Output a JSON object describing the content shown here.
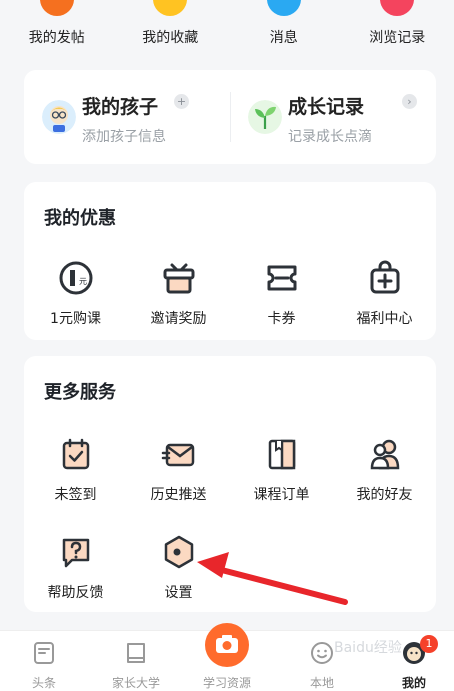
{
  "top_row": [
    {
      "label": "我的发帖",
      "icon": "post-icon",
      "color": "#f5701f"
    },
    {
      "label": "我的收藏",
      "icon": "star-icon",
      "color": "#ffc322"
    },
    {
      "label": "消息",
      "icon": "message-icon",
      "color": "#2aa9f2"
    },
    {
      "label": "浏览记录",
      "icon": "history-icon",
      "color": "#f4445e"
    }
  ],
  "kids": {
    "my_child": {
      "title": "我的孩子",
      "subtitle": "添加孩子信息",
      "badge": "+",
      "icon": "child-avatar-icon"
    },
    "growth": {
      "title": "成长记录",
      "subtitle": "记录成长点滴",
      "badge": "›",
      "icon": "sprout-icon"
    }
  },
  "coupon": {
    "title": "我的优惠",
    "items": [
      {
        "label": "1元购课",
        "icon": "one-yuan-icon"
      },
      {
        "label": "邀请奖励",
        "icon": "gift-box-icon"
      },
      {
        "label": "卡券",
        "icon": "ticket-icon"
      },
      {
        "label": "福利中心",
        "icon": "bag-plus-icon"
      }
    ]
  },
  "more": {
    "title": "更多服务",
    "items": [
      {
        "label": "未签到",
        "icon": "calendar-check-icon"
      },
      {
        "label": "历史推送",
        "icon": "envelope-icon"
      },
      {
        "label": "课程订单",
        "icon": "book-icon"
      },
      {
        "label": "我的好友",
        "icon": "friends-icon"
      },
      {
        "label": "帮助反馈",
        "icon": "help-bubble-icon"
      },
      {
        "label": "设置",
        "icon": "settings-hexagon-icon"
      }
    ]
  },
  "tabbar": {
    "tabs": [
      {
        "label": "头条",
        "icon": "headline-icon"
      },
      {
        "label": "家长大学",
        "icon": "book-stack-icon"
      },
      {
        "label": "学习资源",
        "icon": "camera-icon"
      },
      {
        "label": "本地",
        "icon": "smile-icon"
      },
      {
        "label": "我的",
        "icon": "profile-icon",
        "active": true
      }
    ],
    "notification_count": "1"
  },
  "watermark": "Baidu经验",
  "colors": {
    "accent_orange": "#ff6b2c",
    "arrow_red": "#e8262b",
    "badge_red": "#f5412a",
    "icon_dark": "#2d3238",
    "icon_peach": "#fbd9c2"
  }
}
